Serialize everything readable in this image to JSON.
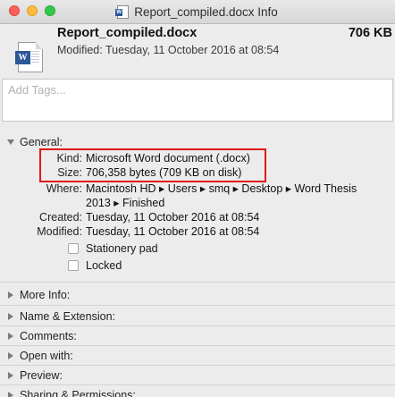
{
  "window": {
    "title": "Report_compiled.docx Info"
  },
  "header": {
    "file_name": "Report_compiled.docx",
    "file_size": "706 KB",
    "modified": "Modified: Tuesday, 11 October 2016 at 08:54"
  },
  "tags": {
    "placeholder": "Add Tags..."
  },
  "general": {
    "header": "General:",
    "kind_label": "Kind:",
    "kind_value": "Microsoft Word document (.docx)",
    "size_label": "Size:",
    "size_value": "706,358 bytes (709 KB on disk)",
    "where_label": "Where:",
    "where_value_line1": "Macintosh HD ▸ Users ▸ smq ▸ Desktop ▸ Word Thesis",
    "where_value_line2": "2013 ▸ Finished",
    "created_label": "Created:",
    "created_value": "Tuesday, 11 October 2016 at 08:54",
    "modified_label": "Modified:",
    "modified_value": "Tuesday, 11 October 2016 at 08:54",
    "stationery_label": "Stationery pad",
    "locked_label": "Locked"
  },
  "sections": {
    "more_info": "More Info:",
    "name_extension": "Name & Extension:",
    "comments": "Comments:",
    "open_with": "Open with:",
    "preview": "Preview:",
    "sharing": "Sharing & Permissions:"
  },
  "colors": {
    "highlight": "#e0181b",
    "word_blue": "#2b5797"
  }
}
